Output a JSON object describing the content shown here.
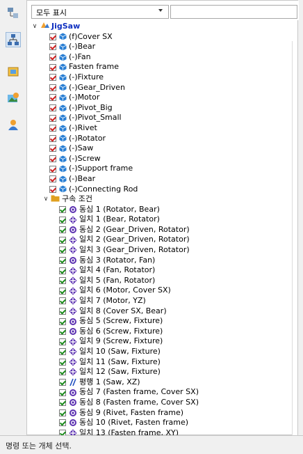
{
  "filter": {
    "selected": "모두 표시",
    "search_value": ""
  },
  "toolbar": {
    "buttons": [
      {
        "icon": "assembly-tree-icon"
      },
      {
        "icon": "hierarchy-icon"
      },
      {
        "icon": "part-box-icon"
      },
      {
        "icon": "image-view-icon"
      },
      {
        "icon": "user-icon"
      }
    ]
  },
  "tree": {
    "root": "JigSaw",
    "parts": [
      {
        "prefix": "(f)",
        "name": "Cover SX"
      },
      {
        "prefix": "(-)",
        "name": "Bear"
      },
      {
        "prefix": "(-)",
        "name": "Fan"
      },
      {
        "prefix": "",
        "name": "Fasten frame"
      },
      {
        "prefix": "(-)",
        "name": "Fixture"
      },
      {
        "prefix": "(-)",
        "name": "Gear_Driven"
      },
      {
        "prefix": "(-)",
        "name": "Motor"
      },
      {
        "prefix": "(-)",
        "name": "Pivot_Big"
      },
      {
        "prefix": "(-)",
        "name": "Pivot_Small"
      },
      {
        "prefix": "(-)",
        "name": "Rivet"
      },
      {
        "prefix": "(-)",
        "name": "Rotator"
      },
      {
        "prefix": "(-)",
        "name": "Saw"
      },
      {
        "prefix": "(-)",
        "name": "Screw"
      },
      {
        "prefix": "(-)",
        "name": "Support frame"
      },
      {
        "prefix": "(-)",
        "name": "Bear"
      },
      {
        "prefix": "(-)",
        "name": "Connecting Rod"
      }
    ],
    "constraints_folder": "구속 조건",
    "constraints": [
      {
        "type": "concentric",
        "label": "동심 1 (Rotator, Bear)"
      },
      {
        "type": "coincident",
        "label": "일치 1 (Bear, Rotator)"
      },
      {
        "type": "concentric",
        "label": "동심 2 (Gear_Driven, Rotator)"
      },
      {
        "type": "coincident",
        "label": "일치 2 (Gear_Driven, Rotator)"
      },
      {
        "type": "coincident",
        "label": "일치 3 (Gear_Driven, Rotator)"
      },
      {
        "type": "concentric",
        "label": "동심 3 (Rotator, Fan)"
      },
      {
        "type": "coincident",
        "label": "일치 4 (Fan, Rotator)"
      },
      {
        "type": "coincident",
        "label": "일치 5 (Fan, Rotator)"
      },
      {
        "type": "coincident",
        "label": "일치 6 (Motor, Cover SX)"
      },
      {
        "type": "coincident",
        "label": "일치 7 (Motor, YZ)"
      },
      {
        "type": "coincident",
        "label": "일치 8 (Cover SX, Bear)"
      },
      {
        "type": "concentric",
        "label": "동심 5 (Screw, Fixture)"
      },
      {
        "type": "concentric",
        "label": "동심 6 (Screw, Fixture)"
      },
      {
        "type": "coincident",
        "label": "일치 9 (Screw, Fixture)"
      },
      {
        "type": "coincident",
        "label": "일치 10 (Saw, Fixture)"
      },
      {
        "type": "coincident",
        "label": "일치 11 (Saw, Fixture)"
      },
      {
        "type": "coincident",
        "label": "일치 12 (Saw, Fixture)"
      },
      {
        "type": "parallel",
        "label": "평행 1 (Saw, XZ)"
      },
      {
        "type": "concentric",
        "label": "동심 7 (Fasten frame, Cover SX)"
      },
      {
        "type": "concentric",
        "label": "동심 8 (Fasten frame, Cover SX)"
      },
      {
        "type": "concentric",
        "label": "동심 9 (Rivet, Fasten frame)"
      },
      {
        "type": "concentric",
        "label": "동심 10 (Rivet, Fasten frame)"
      },
      {
        "type": "coincident",
        "label": "일치 13 (Fasten frame, XY)"
      }
    ]
  },
  "status": "명령 또는 개체 선택.",
  "colors": {
    "part_check": "#d02020",
    "constraint_check": "#1a8a1a",
    "part_icon": "#2a7fd4",
    "constraint_icon": "#5a2fb0",
    "parallel_icon": "#2050c0",
    "folder_icon": "#e0a020",
    "root_text": "#1030c0"
  }
}
